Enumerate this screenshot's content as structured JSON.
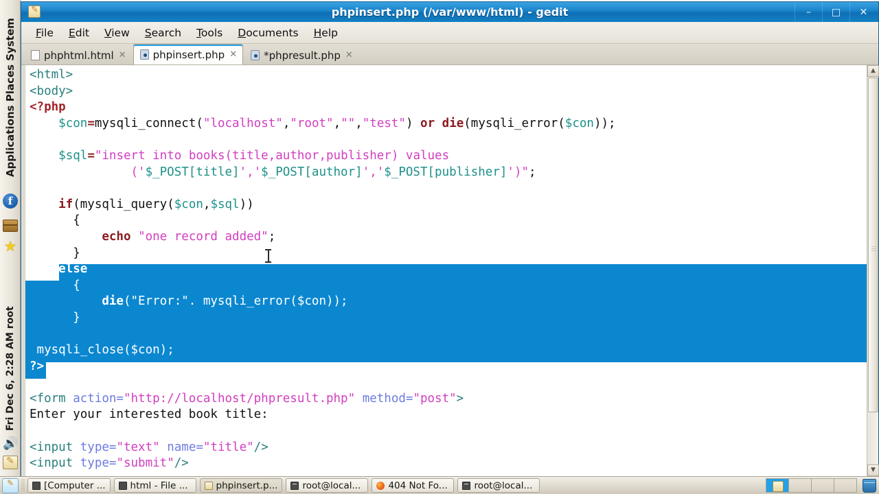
{
  "window": {
    "title": "phpinsert.php (/var/www/html) - gedit",
    "icon": "gedit-icon",
    "buttons": {
      "minimize": "–",
      "maximize": "□",
      "close": "✕"
    }
  },
  "menubar": {
    "items": [
      {
        "label": "File",
        "mnemonic": "F"
      },
      {
        "label": "Edit",
        "mnemonic": "E"
      },
      {
        "label": "View",
        "mnemonic": "V"
      },
      {
        "label": "Search",
        "mnemonic": "S"
      },
      {
        "label": "Tools",
        "mnemonic": "T"
      },
      {
        "label": "Documents",
        "mnemonic": "D"
      },
      {
        "label": "Help",
        "mnemonic": "H"
      }
    ]
  },
  "tabs": [
    {
      "label": "phphtml.html",
      "icon": "html-file-icon",
      "active": false,
      "close": "✕"
    },
    {
      "label": "phpinsert.php",
      "icon": "php-file-icon",
      "active": true,
      "close": "✕"
    },
    {
      "label": "*phpresult.php",
      "icon": "php-file-icon",
      "active": false,
      "close": "✕"
    }
  ],
  "editor": {
    "selection_color": "#0b87d0",
    "lines": [
      "<html>",
      "<body>",
      "<?php",
      "    $con=mysqli_connect(\"localhost\",\"root\",\"\",\"test\") or die(mysqli_error($con));",
      "",
      "    $sql=\"insert into books(title,author,publisher) values",
      "              ('$_POST[title]','$_POST[author]','$_POST[publisher]')\";",
      "",
      "    if(mysqli_query($con,$sql))",
      "      {",
      "          echo \"one record added\";",
      "      }",
      "    else",
      "      {",
      "          die(\"Error:\". mysqli_error($con));",
      "      }",
      "",
      " mysqli_close($con);",
      "?>",
      "",
      "<form action=\"http://localhost/phpresult.php\" method=\"post\">",
      "Enter your interested book title:",
      "",
      "<input type=\"text\" name=\"title\"/>",
      "<input type=\"submit\"/>"
    ]
  },
  "vpanel": {
    "menus": "Applications Places System",
    "clock": "Fri Dec 6,  2:28 AM root",
    "fedora_glyph": "f",
    "speaker_glyph": "◂))",
    "icons": [
      "fedora-icon",
      "package-icon",
      "star-icon",
      "volume-icon",
      "gedit-launcher-icon"
    ]
  },
  "taskbar": {
    "tasks": [
      {
        "label": "[Computer ...",
        "icon": "file-manager-icon",
        "active": false
      },
      {
        "label": "html - File ...",
        "icon": "file-manager-icon",
        "active": false
      },
      {
        "label": "phpinsert.p...",
        "icon": "gedit-icon",
        "active": true
      },
      {
        "label": "root@local...",
        "icon": "terminal-icon",
        "active": false
      },
      {
        "label": "404 Not Fo...",
        "icon": "firefox-icon",
        "active": false
      },
      {
        "label": "root@local...",
        "icon": "terminal-icon",
        "active": false
      }
    ],
    "workspaces": [
      {
        "name": "workspace-1",
        "active": true
      },
      {
        "name": "workspace-2",
        "active": false
      },
      {
        "name": "workspace-3",
        "active": false
      },
      {
        "name": "workspace-4",
        "active": false
      }
    ],
    "trash": "trash-icon"
  },
  "scrollbar": {
    "up_arrow": "▲",
    "down_arrow": "▼"
  }
}
